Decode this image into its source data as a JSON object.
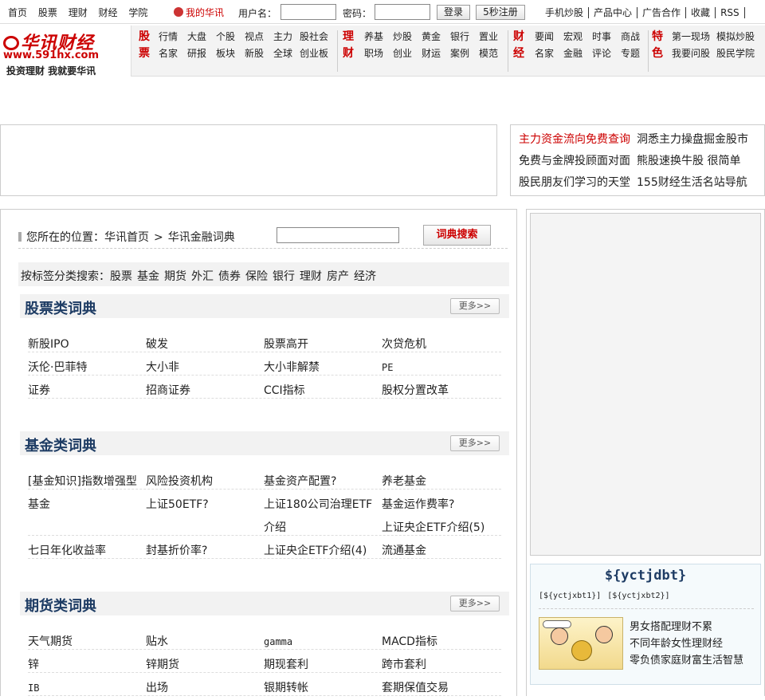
{
  "topnav": [
    "首页",
    "股票",
    "理财",
    "财经",
    "学院"
  ],
  "my_hx": "我的华讯",
  "login": {
    "user_label": "用户名：",
    "pwd_label": "密码：",
    "login_btn": "登录",
    "reg_btn": "5秒注册"
  },
  "toplinks": [
    "手机炒股",
    "产品中心",
    "广告合作",
    "收藏",
    "RSS"
  ],
  "logo": {
    "name": "华讯财经",
    "url": "www.591hx.com",
    "slogan": "投资理财   我就要华讯"
  },
  "nav": [
    {
      "cat": "股票",
      "rows": [
        [
          "行情",
          "大盘",
          "个股",
          "视点",
          "主力",
          "股社会"
        ],
        [
          "名家",
          "研报",
          "板块",
          "新股",
          "全球",
          "创业板"
        ]
      ]
    },
    {
      "cat": "理财",
      "rows": [
        [
          "养基",
          "炒股",
          "黄金",
          "银行",
          "置业"
        ],
        [
          "职场",
          "创业",
          "财运",
          "案例",
          "模范"
        ]
      ]
    },
    {
      "cat": "财经",
      "rows": [
        [
          "要闻",
          "宏观",
          "时事",
          "商战"
        ],
        [
          "名家",
          "金融",
          "评论",
          "专题"
        ]
      ]
    },
    {
      "cat": "特色",
      "rows": [
        [
          "第一现场",
          "模拟炒股"
        ],
        [
          "我要问股",
          "股民学院"
        ]
      ]
    }
  ],
  "banner_right": [
    [
      "主力资金流向免费查询",
      "洞悉主力操盘掘金股市"
    ],
    [
      "免费与金牌投顾面对面",
      "熊股速换牛股 很简单"
    ],
    [
      "股民朋友们学习的天堂",
      "155财经生活名站导航"
    ]
  ],
  "breadcrumb": {
    "prefix": "您所在的位置：",
    "home": "华讯首页",
    "arrow": ">",
    "current": "华讯金融词典"
  },
  "dict_btn": "词典搜索",
  "tagbar": {
    "label": "按标签分类搜索：",
    "tags": [
      "股票",
      "基金",
      "期货",
      "外汇",
      "债券",
      "保险",
      "银行",
      "理财",
      "房产",
      "经济"
    ]
  },
  "more_label": "更多>>",
  "sections": [
    {
      "title": "股票类词典",
      "rows": [
        [
          "新股IPO",
          "破发",
          "股票高开",
          "次贷危机"
        ],
        [
          "沃伦·巴菲特",
          "大小非",
          "大小非解禁",
          "PE"
        ],
        [
          "证券",
          "招商证券",
          "CCI指标",
          "股权分置改革"
        ]
      ]
    },
    {
      "title": "基金类词典",
      "rows": [
        [
          "[基金知识]指数增强型",
          "风险投资机构",
          "基金资产配置?",
          "养老基金"
        ],
        [
          "基金",
          "上证50ETF?",
          "上证180公司治理ETF介绍",
          "基金运作费率?"
        ],
        [
          "七日年化收益率",
          "封基折价率?",
          "上证央企ETF介绍(4)",
          "流通基金"
        ]
      ],
      "extra": "上证央企ETF介绍(5)"
    },
    {
      "title": "期货类词典",
      "rows": [
        [
          "天气期货",
          "贴水",
          "gamma",
          "MACD指标"
        ],
        [
          "锌",
          "锌期货",
          "期现套利",
          "跨市套利"
        ],
        [
          "IB",
          "出场",
          "银期转帐",
          "套期保值交易"
        ]
      ]
    }
  ],
  "side": {
    "title": "${yctjdbt}",
    "links": [
      "[${yctjxbt1}]",
      "[${yctjxbt2}]"
    ],
    "list": [
      "男女搭配理财不累",
      "不同年龄女性理财经",
      "零负债家庭财富生活智慧"
    ]
  }
}
